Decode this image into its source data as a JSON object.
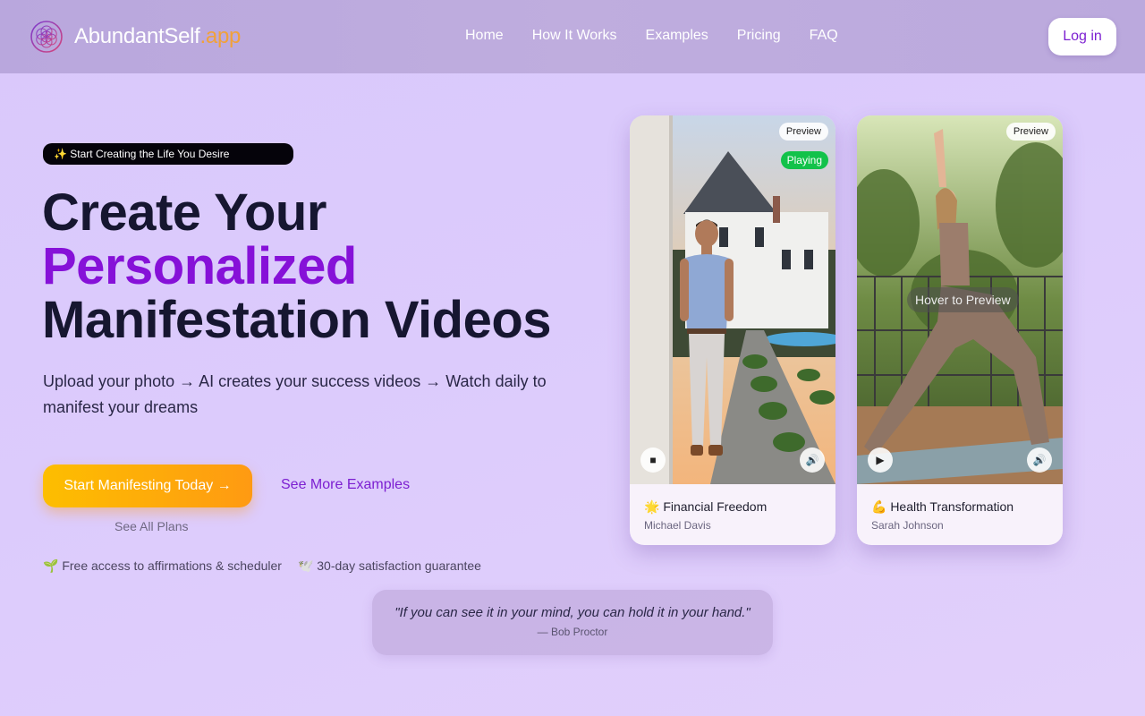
{
  "header": {
    "brand_main": "AbundantSelf",
    "brand_tld": ".app",
    "nav": [
      "Home",
      "How It Works",
      "Examples",
      "Pricing",
      "FAQ"
    ],
    "login_label": "Log in"
  },
  "hero": {
    "pill": "✨ Start Creating the Life You Desire",
    "headline_line1": "Create Your",
    "headline_accent": "Personalized",
    "headline_line3": "Manifestation Videos",
    "subtitle": "Upload your photo → AI creates your success videos → Watch daily to manifest your dreams",
    "cta_label": "Start Manifesting Today →",
    "more_label": "See More Examples",
    "plans_label": "See All Plans",
    "perk1": "🌱 Free access to affirmations & scheduler",
    "perk2": "🕊️ 30-day satisfaction guarantee"
  },
  "quote": {
    "text": "\"If you can see it in your mind, you can hold it in your hand.\"",
    "author": "— Bob Proctor"
  },
  "cards": [
    {
      "badge": "Preview",
      "status": "Playing",
      "play_icon": "■",
      "sound_icon": "🔊",
      "title": "🌟 Financial Freedom",
      "person": "Michael Davis"
    },
    {
      "badge": "Preview",
      "hint": "Hover to Preview",
      "play_icon": "▶",
      "sound_icon": "🔊",
      "title": "💪 Health Transformation",
      "person": "Sarah Johnson"
    }
  ],
  "colors": {
    "accent_purple": "#8611d8",
    "cta_start": "#fdbe00",
    "cta_end": "#ff9a12",
    "playing_green": "#12c24a",
    "tld_orange": "#f1a13a"
  }
}
